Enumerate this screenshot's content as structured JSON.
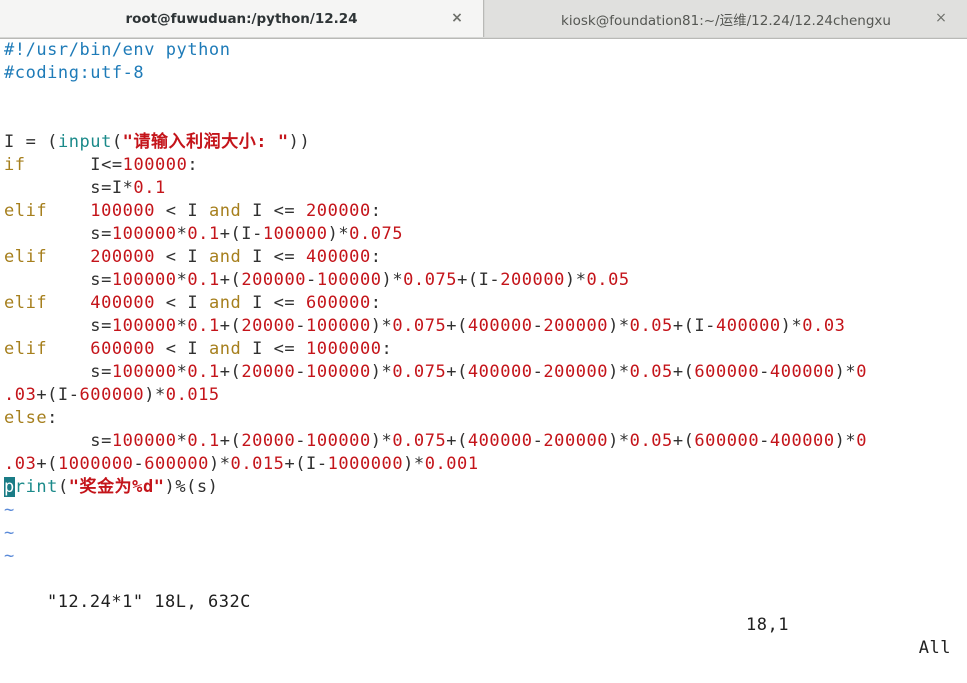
{
  "tabs": [
    {
      "title": "root@fuwuduan:/python/12.24",
      "close": "×"
    },
    {
      "title": "kiosk@foundation81:~/运维/12.24/12.24chengxu",
      "close": "×"
    }
  ],
  "code": {
    "l1": "#!/usr/bin/env python",
    "l2": "#coding:utf-8",
    "l5a": "I = (",
    "l5b": "input",
    "l5c": "(",
    "l5d": "\"请输入利润大小: \"",
    "l5e": "))",
    "kw_if": "if",
    "kw_elif": "elif",
    "kw_else": "else",
    "kw_and": "and",
    "l6": "I<=",
    "l6n": "100000",
    "l6c": ":",
    "l7": "s=I*",
    "l7n": "0.1",
    "print_cursor": "p",
    "print_rest": "rint",
    "print_str": "\"奖金为%d\"",
    "print_tail": ")%(s)",
    "tilde": "~"
  },
  "status": {
    "file": "\"12.24*1\" 18L, 632C",
    "position": "18,1",
    "scroll": "All"
  }
}
